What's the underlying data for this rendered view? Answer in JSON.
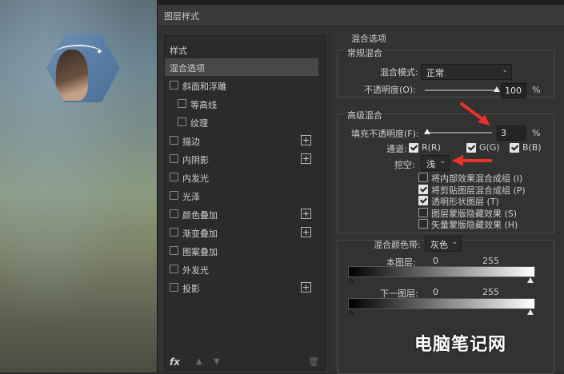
{
  "dialog": {
    "title": "图层样式"
  },
  "left_panel": {
    "header": "样式",
    "items": [
      {
        "label": "混合选项",
        "selected": true,
        "checkbox": false,
        "indent": 0,
        "plus": false
      },
      {
        "label": "斜面和浮雕",
        "checkbox": true,
        "indent": 0,
        "plus": false
      },
      {
        "label": "等高线",
        "checkbox": true,
        "indent": 1,
        "plus": false
      },
      {
        "label": "纹理",
        "checkbox": true,
        "indent": 1,
        "plus": false
      },
      {
        "label": "描边",
        "checkbox": true,
        "indent": 0,
        "plus": true
      },
      {
        "label": "内阴影",
        "checkbox": true,
        "indent": 0,
        "plus": true
      },
      {
        "label": "内发光",
        "checkbox": true,
        "indent": 0,
        "plus": false
      },
      {
        "label": "光泽",
        "checkbox": true,
        "indent": 0,
        "plus": false
      },
      {
        "label": "颜色叠加",
        "checkbox": true,
        "indent": 0,
        "plus": true
      },
      {
        "label": "渐变叠加",
        "checkbox": true,
        "indent": 0,
        "plus": true
      },
      {
        "label": "图案叠加",
        "checkbox": true,
        "indent": 0,
        "plus": false
      },
      {
        "label": "外发光",
        "checkbox": true,
        "indent": 0,
        "plus": false
      },
      {
        "label": "投影",
        "checkbox": true,
        "indent": 0,
        "plus": true
      }
    ],
    "fx_label": "fx"
  },
  "blend_options": {
    "heading": "混合选项",
    "general": {
      "legend": "常规混合",
      "mode_label": "混合模式:",
      "mode_value": "正常",
      "opacity_label": "不透明度(O):",
      "opacity_value": "100",
      "opacity_percent": 100,
      "pct": "%"
    },
    "advanced": {
      "legend": "高级混合",
      "fill_label": "填充不透明度(F):",
      "fill_value": "3",
      "fill_percent": 3,
      "pct": "%",
      "channels_label": "通道:",
      "channels": [
        {
          "label": "R(R)",
          "checked": true
        },
        {
          "label": "G(G)",
          "checked": true
        },
        {
          "label": "B(B)",
          "checked": true
        }
      ],
      "knockout_label": "挖空:",
      "knockout_value": "浅",
      "options": [
        {
          "label": "将内部效果混合成组 (I)",
          "checked": false
        },
        {
          "label": "将剪贴图层混合成组 (P)",
          "checked": true
        },
        {
          "label": "透明形状图层 (T)",
          "checked": true
        },
        {
          "label": "图层蒙版隐藏效果 (S)",
          "checked": false
        },
        {
          "label": "矢量蒙版隐藏效果 (H)",
          "checked": false
        }
      ]
    },
    "blend_if": {
      "label": "混合颜色带:",
      "value": "灰色",
      "this_layer": {
        "label": "本图层:",
        "min": "0",
        "max": "255"
      },
      "underlying": {
        "label": "下一图层:",
        "min": "0",
        "max": "255"
      }
    }
  },
  "watermark": "电脑笔记网",
  "colors": {
    "annotation_arrow": "#e8332a",
    "dialog_bg": "#323232"
  }
}
